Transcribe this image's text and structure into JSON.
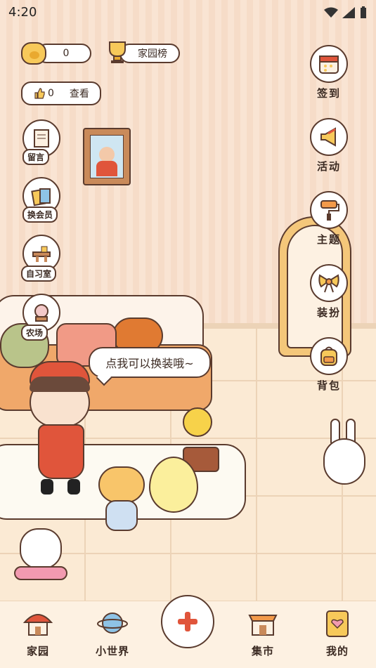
{
  "status_bar": {
    "time": "4:20"
  },
  "currency": {
    "coins": "0"
  },
  "ranking": {
    "label": "家园榜"
  },
  "likes": {
    "count": "0",
    "view_label": "查看"
  },
  "left_menu": [
    {
      "label": "留言",
      "icon": "note-icon"
    },
    {
      "label": "换会员",
      "icon": "vip-card-icon"
    },
    {
      "label": "自习室",
      "icon": "desk-icon"
    },
    {
      "label": "农场",
      "icon": "farm-icon"
    }
  ],
  "right_menu": [
    {
      "label": "签到",
      "icon": "calendar-icon"
    },
    {
      "label": "活动",
      "icon": "megaphone-icon"
    },
    {
      "label": "主题",
      "icon": "paint-roller-icon"
    },
    {
      "label": "装扮",
      "icon": "bow-icon"
    },
    {
      "label": "背包",
      "icon": "backpack-icon"
    }
  ],
  "speech_bubble": {
    "text": "点我可以换装哦~"
  },
  "bottom_nav": [
    {
      "label": "家园",
      "icon": "house-icon"
    },
    {
      "label": "小世界",
      "icon": "planet-icon"
    },
    {
      "label": "",
      "icon": "plus-icon"
    },
    {
      "label": "集市",
      "icon": "market-icon"
    },
    {
      "label": "我的",
      "icon": "profile-card-icon"
    }
  ],
  "colors": {
    "outline": "#5a3b2e",
    "accent": "#e0553b",
    "wall": "#f9e4d3",
    "floor": "#fbead4"
  }
}
